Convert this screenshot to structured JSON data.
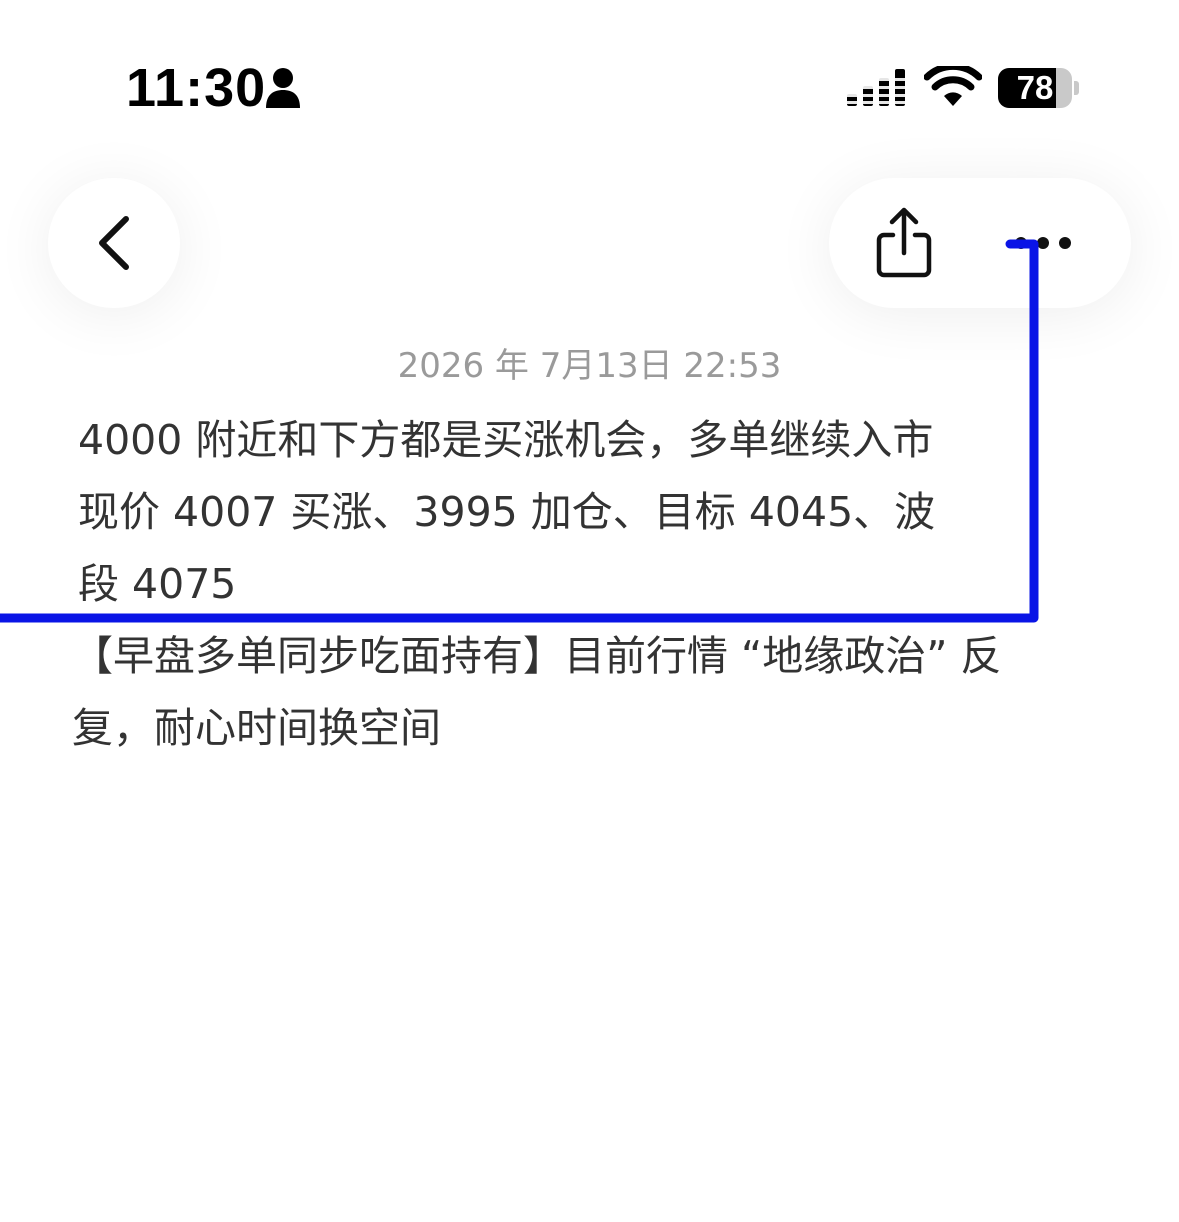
{
  "status_bar": {
    "time": "11:30",
    "battery_level": "78",
    "battery_fraction": 0.78,
    "icons": [
      "person-icon",
      "signal-icon",
      "wifi-icon",
      "battery-icon"
    ]
  },
  "nav": {
    "back_icon": "chevron-left-icon",
    "share_icon": "share-icon",
    "more_icon": "ellipsis-icon"
  },
  "note": {
    "date": "2026 年 7月13日 22:53",
    "paragraphs": [
      "4000 附近和下方都是买涨机会，多单继续入市\n现价 4007 买涨、3995 加仓、目标 4045、波\n段 4075",
      "【早盘多单同步吃面持有】目前行情 “地缘政治” 反\n复，耐心时间换空间"
    ]
  },
  "colors": {
    "annotation_stroke": "#0a14e6",
    "text": "#333333",
    "date_text": "#9a9a9a",
    "background": "#ffffff"
  }
}
